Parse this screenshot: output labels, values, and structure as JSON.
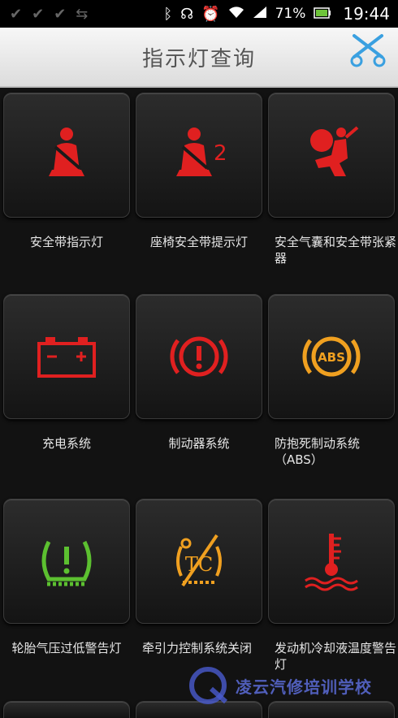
{
  "status_bar": {
    "battery_percent": "71%",
    "time": "19:44"
  },
  "header": {
    "title": "指示灯查询"
  },
  "indicators": [
    {
      "label": "安全带指示灯",
      "icon": "seatbelt-icon",
      "color": "#e02020"
    },
    {
      "label": "座椅安全带提示灯",
      "icon": "seatbelt-2-icon",
      "color": "#e02020"
    },
    {
      "label": "安全气囊和安全带张紧器",
      "icon": "airbag-icon",
      "color": "#e02020"
    },
    {
      "label": "充电系统",
      "icon": "battery-icon",
      "color": "#e02020"
    },
    {
      "label": "制动器系统",
      "icon": "brake-icon",
      "color": "#e02020"
    },
    {
      "label": "防抱死制动系统（ABS）",
      "icon": "abs-icon",
      "color": "#f0a020"
    },
    {
      "label": "轮胎气压过低警告灯",
      "icon": "tire-pressure-icon",
      "color": "#5cc030"
    },
    {
      "label": "牵引力控制系统关闭",
      "icon": "traction-control-off-icon",
      "color": "#f0a020"
    },
    {
      "label": "发动机冷却液温度警告灯",
      "icon": "coolant-temp-icon",
      "color": "#e02020"
    }
  ],
  "watermark": {
    "text": "凌云汽修培训学校"
  }
}
